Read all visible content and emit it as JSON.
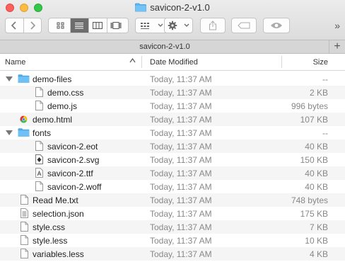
{
  "window": {
    "title": "savicon-2-v1.0"
  },
  "tab": {
    "label": "savicon-2-v1.0",
    "plus": "+"
  },
  "toolbar": {
    "overflow": "»"
  },
  "columns": {
    "name": "Name",
    "date": "Date Modified",
    "size": "Size"
  },
  "files": [
    {
      "name": "demo-files",
      "date": "Today, 11:37 AM",
      "size": "--",
      "kind": "folder",
      "expanded": true
    },
    {
      "name": "demo.css",
      "date": "Today, 11:37 AM",
      "size": "2 KB",
      "kind": "doc"
    },
    {
      "name": "demo.js",
      "date": "Today, 11:37 AM",
      "size": "996 bytes",
      "kind": "doc"
    },
    {
      "name": "demo.html",
      "date": "Today, 11:37 AM",
      "size": "107 KB",
      "kind": "chrome"
    },
    {
      "name": "fonts",
      "date": "Today, 11:37 AM",
      "size": "--",
      "kind": "folder",
      "expanded": true
    },
    {
      "name": "savicon-2.eot",
      "date": "Today, 11:37 AM",
      "size": "40 KB",
      "kind": "doc"
    },
    {
      "name": "savicon-2.svg",
      "date": "Today, 11:37 AM",
      "size": "150 KB",
      "kind": "svgdoc"
    },
    {
      "name": "savicon-2.ttf",
      "date": "Today, 11:37 AM",
      "size": "40 KB",
      "kind": "font"
    },
    {
      "name": "savicon-2.woff",
      "date": "Today, 11:37 AM",
      "size": "40 KB",
      "kind": "doc"
    },
    {
      "name": "Read Me.txt",
      "date": "Today, 11:37 AM",
      "size": "748 bytes",
      "kind": "doc"
    },
    {
      "name": "selection.json",
      "date": "Today, 11:37 AM",
      "size": "175 KB",
      "kind": "lines"
    },
    {
      "name": "style.css",
      "date": "Today, 11:37 AM",
      "size": "7 KB",
      "kind": "doc"
    },
    {
      "name": "style.less",
      "date": "Today, 11:37 AM",
      "size": "10 KB",
      "kind": "doc"
    },
    {
      "name": "variables.less",
      "date": "Today, 11:37 AM",
      "size": "4 KB",
      "kind": "doc"
    }
  ],
  "colors": {
    "folder": "#5fb6f2",
    "selected_view": "#6d6d6d",
    "muted_text": "#888888"
  }
}
